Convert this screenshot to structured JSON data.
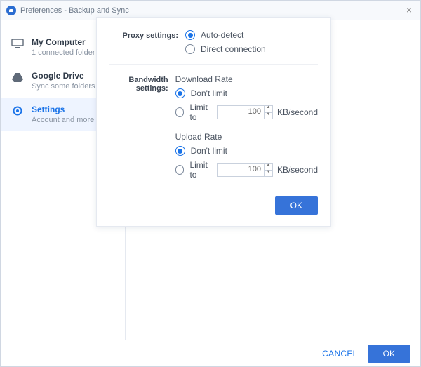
{
  "window": {
    "title": "Preferences - Backup and Sync"
  },
  "sidebar": {
    "items": [
      {
        "title": "My Computer",
        "subtitle": "1 connected folder"
      },
      {
        "title": "Google Drive",
        "subtitle": "Sync some folders"
      },
      {
        "title": "Settings",
        "subtitle": "Account and more"
      }
    ]
  },
  "dialog": {
    "proxy": {
      "label": "Proxy settings:",
      "auto_detect": "Auto-detect",
      "direct": "Direct connection"
    },
    "bandwidth": {
      "label": "Bandwidth settings:",
      "download_head": "Download Rate",
      "upload_head": "Upload Rate",
      "dont_limit": "Don't limit",
      "limit_to": "Limit to",
      "unit": "KB/second",
      "download_value": "100",
      "upload_value": "100"
    },
    "ok": "OK"
  },
  "footer": {
    "cancel": "CANCEL",
    "ok": "OK"
  }
}
